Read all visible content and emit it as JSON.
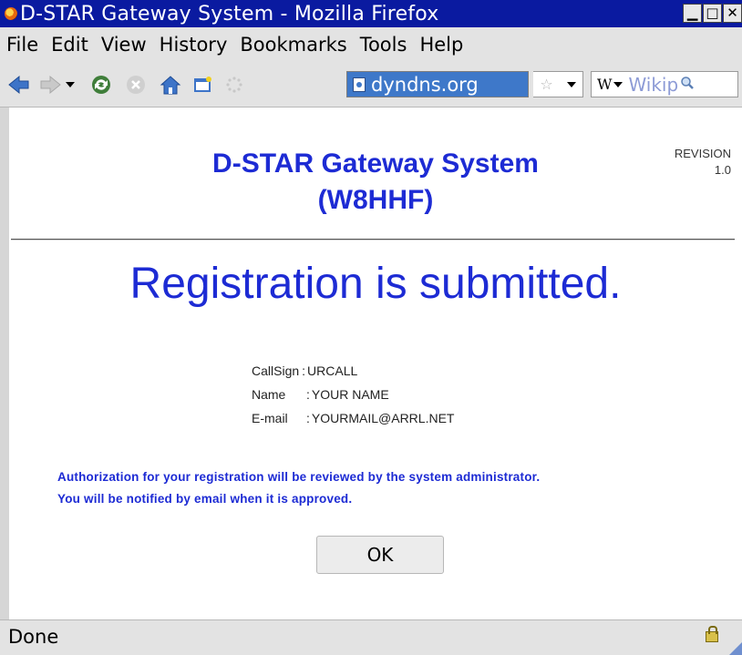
{
  "window": {
    "title": "D-STAR Gateway System - Mozilla Firefox",
    "minimize": "▁",
    "maximize": "□",
    "close": "✕"
  },
  "menu": {
    "items": [
      "File",
      "Edit",
      "View",
      "History",
      "Bookmarks",
      "Tools",
      "Help"
    ]
  },
  "toolbar": {
    "url": "dyndns.org",
    "search_engine": "W",
    "search_placeholder": "Wikip"
  },
  "page": {
    "title_line1": "D-STAR Gateway System",
    "title_line2": "(W8HHF)",
    "revision_label": "REVISION",
    "revision_value": "1.0",
    "headline": "Registration is submitted.",
    "fields": [
      {
        "label": "CallSign",
        "sep": ":",
        "value": "URCALL"
      },
      {
        "label": "Name",
        "sep": ":",
        "value": "YOUR NAME"
      },
      {
        "label": "E-mail",
        "sep": ":",
        "value": "YOURMAIL@ARRL.NET"
      }
    ],
    "note_line1": "Authorization for your registration will be reviewed by the system administrator.",
    "note_line2": "You will be notified by email when it is approved.",
    "ok_label": "OK"
  },
  "status": {
    "text": "Done"
  },
  "colors": {
    "accent_blue": "#1d2bd4",
    "titlebar": "#0a1aa0"
  }
}
